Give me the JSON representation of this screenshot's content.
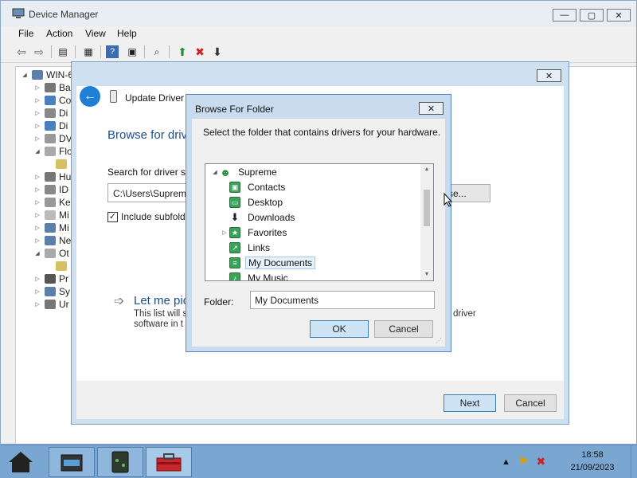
{
  "window": {
    "title": "Device Manager",
    "minimize": "—",
    "maximize": "▢",
    "close": "✕"
  },
  "menu": [
    "File",
    "Action",
    "View",
    "Help"
  ],
  "toolbar_icons": [
    "back-icon",
    "forward-icon",
    "show-hide-console-tree-icon",
    "properties-icon",
    "help-icon",
    "action-pane-icon",
    "scan-hardware-icon",
    "update-driver-icon",
    "uninstall-device-icon",
    "enable-device-icon"
  ],
  "tree": {
    "root": "WIN-6",
    "items": [
      "Ba",
      "Co",
      "Di",
      "Di",
      "DV",
      "Flo",
      "",
      "Hu",
      "ID",
      "Ke",
      "Mi",
      "Mi",
      "Ne",
      "Ot",
      "",
      "Pr",
      "Sy",
      "Ur"
    ]
  },
  "wizard": {
    "close": "✕",
    "title": "Update Driver S",
    "heading": "Browse for driv",
    "search_label": "Search for driver sc",
    "path_value": "C:\\Users\\Supreme",
    "browse_label": "se...",
    "include_subfolders": "Include subfold",
    "include_checked": "✓",
    "letme_title": "Let me pic",
    "letme_desc_line1": "This list will s",
    "letme_desc_line2": "software in t",
    "letme_desc_right": "driver",
    "next": "Next",
    "cancel": "Cancel"
  },
  "browse_folder": {
    "title": "Browse For Folder",
    "close": "✕",
    "instruction": "Select the folder that contains drivers for your hardware.",
    "tree": [
      {
        "label": "Supreme",
        "arrow": "◢",
        "icon": "user-icon"
      },
      {
        "label": "Contacts",
        "arrow": "",
        "icon": "contacts-folder-icon"
      },
      {
        "label": "Desktop",
        "arrow": "",
        "icon": "desktop-folder-icon"
      },
      {
        "label": "Downloads",
        "arrow": "",
        "icon": "downloads-folder-icon"
      },
      {
        "label": "Favorites",
        "arrow": "▷",
        "icon": "favorites-folder-icon"
      },
      {
        "label": "Links",
        "arrow": "",
        "icon": "links-folder-icon"
      },
      {
        "label": "My Documents",
        "arrow": "",
        "icon": "documents-folder-icon",
        "selected": true
      },
      {
        "label": "My Music",
        "arrow": "",
        "icon": "music-folder-icon"
      }
    ],
    "folder_label": "Folder:",
    "folder_value": "My Documents",
    "ok": "OK",
    "cancel": "Cancel"
  },
  "taskbar": {
    "apps": [
      "file-explorer-icon",
      "calculator-icon",
      "toolbox-icon"
    ],
    "time": "18:58",
    "date": "21/09/2023"
  },
  "colors": {
    "accent": "#1f7fd6",
    "heading_blue": "#1c4f8a",
    "taskbar": "#7aa7d2"
  }
}
